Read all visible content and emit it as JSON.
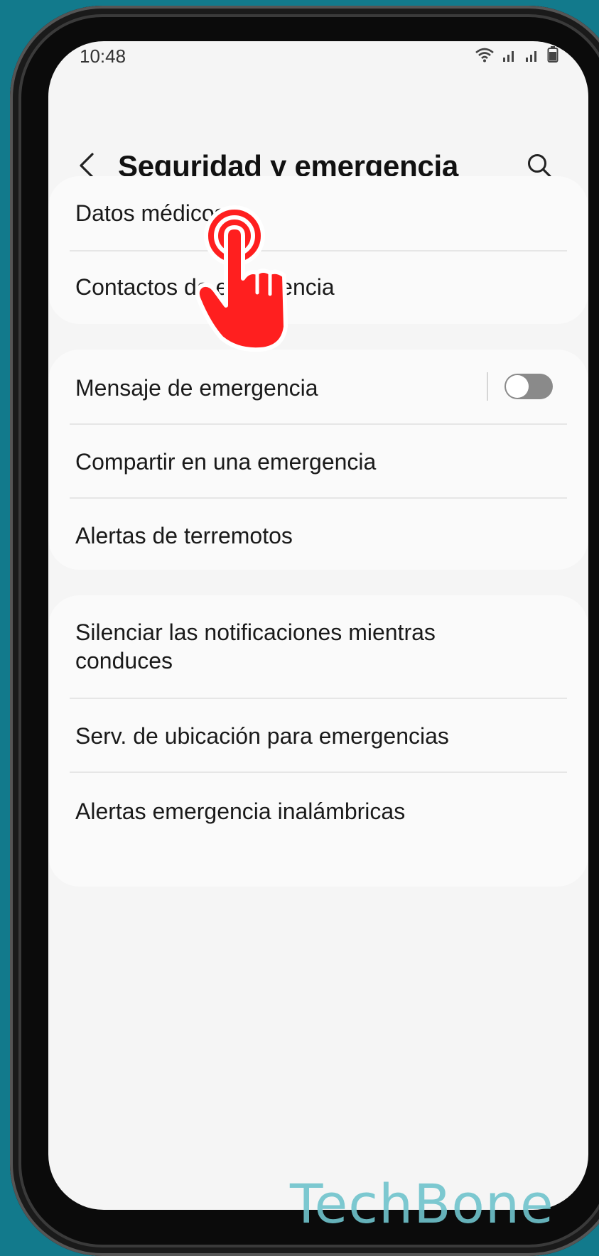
{
  "status_bar": {
    "time": "10:48",
    "icons": [
      "wifi-icon",
      "signal-icon",
      "signal-icon",
      "battery-icon"
    ]
  },
  "header": {
    "back_icon": "chevron-left-icon",
    "title": "Seguridad y emergencia",
    "search_icon": "search-icon"
  },
  "groups": [
    {
      "items": [
        {
          "label": "Datos médicos"
        },
        {
          "label": "Contactos de emergencia"
        }
      ]
    },
    {
      "items": [
        {
          "label": "Mensaje de emergencia",
          "toggle": false
        },
        {
          "label": "Compartir en una emergencia"
        },
        {
          "label": "Alertas de terremotos"
        }
      ]
    },
    {
      "items": [
        {
          "label": "Silenciar las notificaciones mientras conduces"
        },
        {
          "label": "Serv. de ubicación para emergencias"
        },
        {
          "label": "Alertas emergencia inalámbricas"
        }
      ]
    }
  ],
  "overlay": {
    "tap_icon": "tap-hand-icon",
    "tap_color": "#ff1f1f"
  },
  "watermark": {
    "text": "TechBone",
    "color": "#6fc4cc"
  },
  "colors": {
    "background": "#127a8c",
    "screen": "#f5f5f5",
    "card": "#fafafa"
  }
}
